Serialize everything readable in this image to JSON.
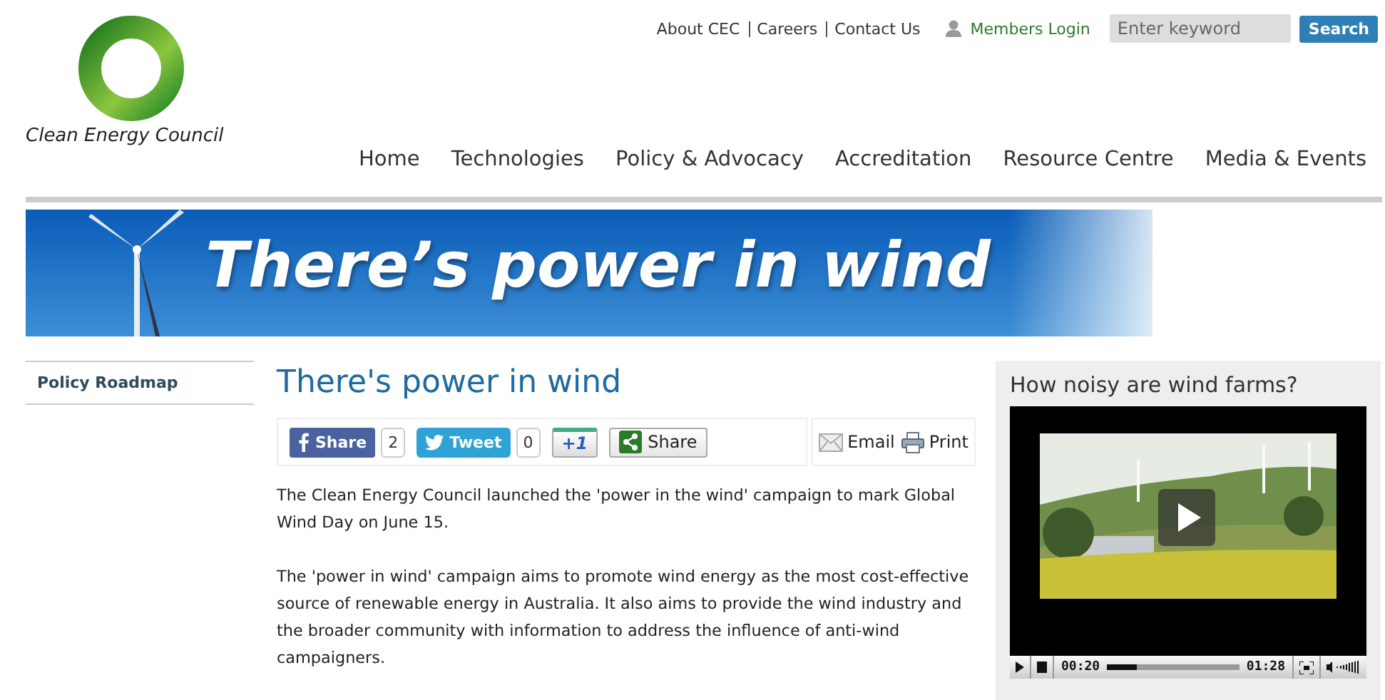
{
  "logo": {
    "name": "Clean Energy Council"
  },
  "top_links": [
    "About CEC",
    "Careers",
    "Contact Us"
  ],
  "members_login": "Members Login",
  "search": {
    "placeholder": "Enter keyword",
    "button": "Search"
  },
  "nav": [
    {
      "label": "Home",
      "selected": false
    },
    {
      "label": "Technologies",
      "selected": false
    },
    {
      "label": "Policy & Advocacy",
      "selected": false
    },
    {
      "label": "Accreditation",
      "selected": false
    },
    {
      "label": "Resource Centre",
      "selected": false
    },
    {
      "label": "Media & Events",
      "selected": false
    }
  ],
  "banner": {
    "headline": "There’s power in wind"
  },
  "sidebar": {
    "items": [
      {
        "label": "Policy Roadmap",
        "selected": false
      }
    ]
  },
  "article": {
    "title": "There's power in wind",
    "share": [
      {
        "kind": "facebook",
        "label": "Share",
        "count": "2"
      },
      {
        "kind": "twitter",
        "label": "Tweet",
        "count": "0"
      },
      {
        "kind": "plusone",
        "label": "+1"
      },
      {
        "kind": "share",
        "label": "Share"
      }
    ],
    "tools": [
      {
        "kind": "email",
        "label": "Email"
      },
      {
        "kind": "print",
        "label": "Print"
      }
    ],
    "paragraphs": [
      "The Clean Energy Council launched the 'power in the wind' campaign to mark Global Wind Day on June 15.",
      "The 'power in wind' campaign aims to promote wind energy as the most cost-effective source of renewable energy in Australia. It also aims to provide the wind industry and the broader community with information to address the influence of anti-wind campaigners."
    ]
  },
  "video": {
    "title": "How noisy are wind farms?",
    "elapsed": "00:20",
    "duration": "01:28",
    "level": 0.23
  }
}
